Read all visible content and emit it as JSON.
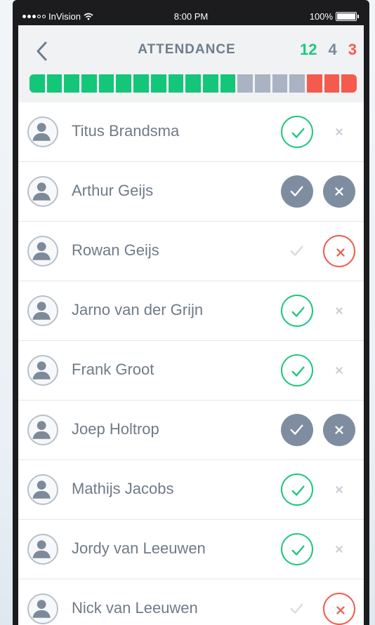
{
  "status_bar": {
    "carrier": "InVision",
    "time": "8:00 PM",
    "battery": "100%"
  },
  "header": {
    "title": "ATTENDANCE",
    "counts": {
      "present": "12",
      "unknown": "4",
      "absent": "3"
    }
  },
  "progress": {
    "present": 12,
    "unknown": 4,
    "absent": 3,
    "colors": {
      "present": "#14c678",
      "unknown": "#aab3c3",
      "absent": "#f45b4d"
    }
  },
  "members": [
    {
      "name": "Titus Brandsma",
      "status": "present"
    },
    {
      "name": "Arthur Geijs",
      "status": "unknown"
    },
    {
      "name": "Rowan Geijs",
      "status": "absent"
    },
    {
      "name": "Jarno van der Grijn",
      "status": "present"
    },
    {
      "name": "Frank Groot",
      "status": "present"
    },
    {
      "name": "Joep Holtrop",
      "status": "unknown"
    },
    {
      "name": "Mathijs Jacobs",
      "status": "present"
    },
    {
      "name": "Jordy van Leeuwen",
      "status": "present"
    },
    {
      "name": "Nick van Leeuwen",
      "status": "absent"
    }
  ],
  "icons": {
    "back": "chevron-left-icon",
    "avatar": "user-avatar-icon",
    "check": "check-icon",
    "close": "close-icon"
  }
}
